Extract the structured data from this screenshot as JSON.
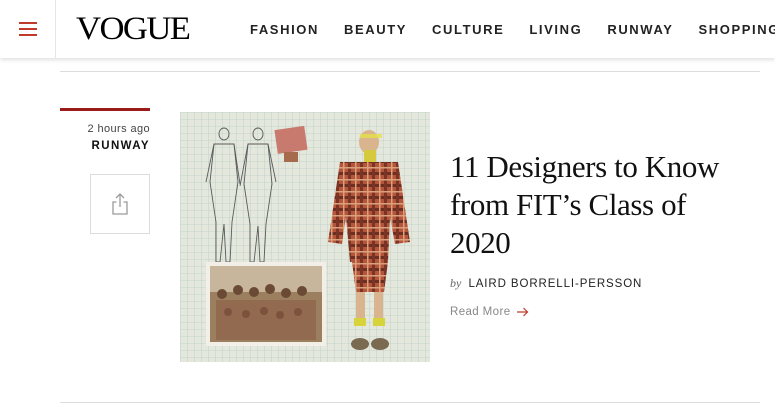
{
  "header": {
    "logo": "VOGUE",
    "nav": [
      "FASHION",
      "BEAUTY",
      "CULTURE",
      "LIVING",
      "RUNWAY",
      "SHOPPING"
    ]
  },
  "article": {
    "time": "2 hours ago",
    "category": "RUNWAY",
    "title": "11 Designers to Know from FIT’s Class of 2020",
    "by": "by",
    "author": "LAIRD BORRELLI-PERSSON",
    "read_more": "Read More"
  },
  "colors": {
    "accent": "#9b1a1a",
    "rule": "#dcdcdc",
    "menu_icon": "#c0392b"
  },
  "icons": {
    "menu": "hamburger-icon",
    "share": "share-icon",
    "read_more": "arrow-right-icon"
  }
}
